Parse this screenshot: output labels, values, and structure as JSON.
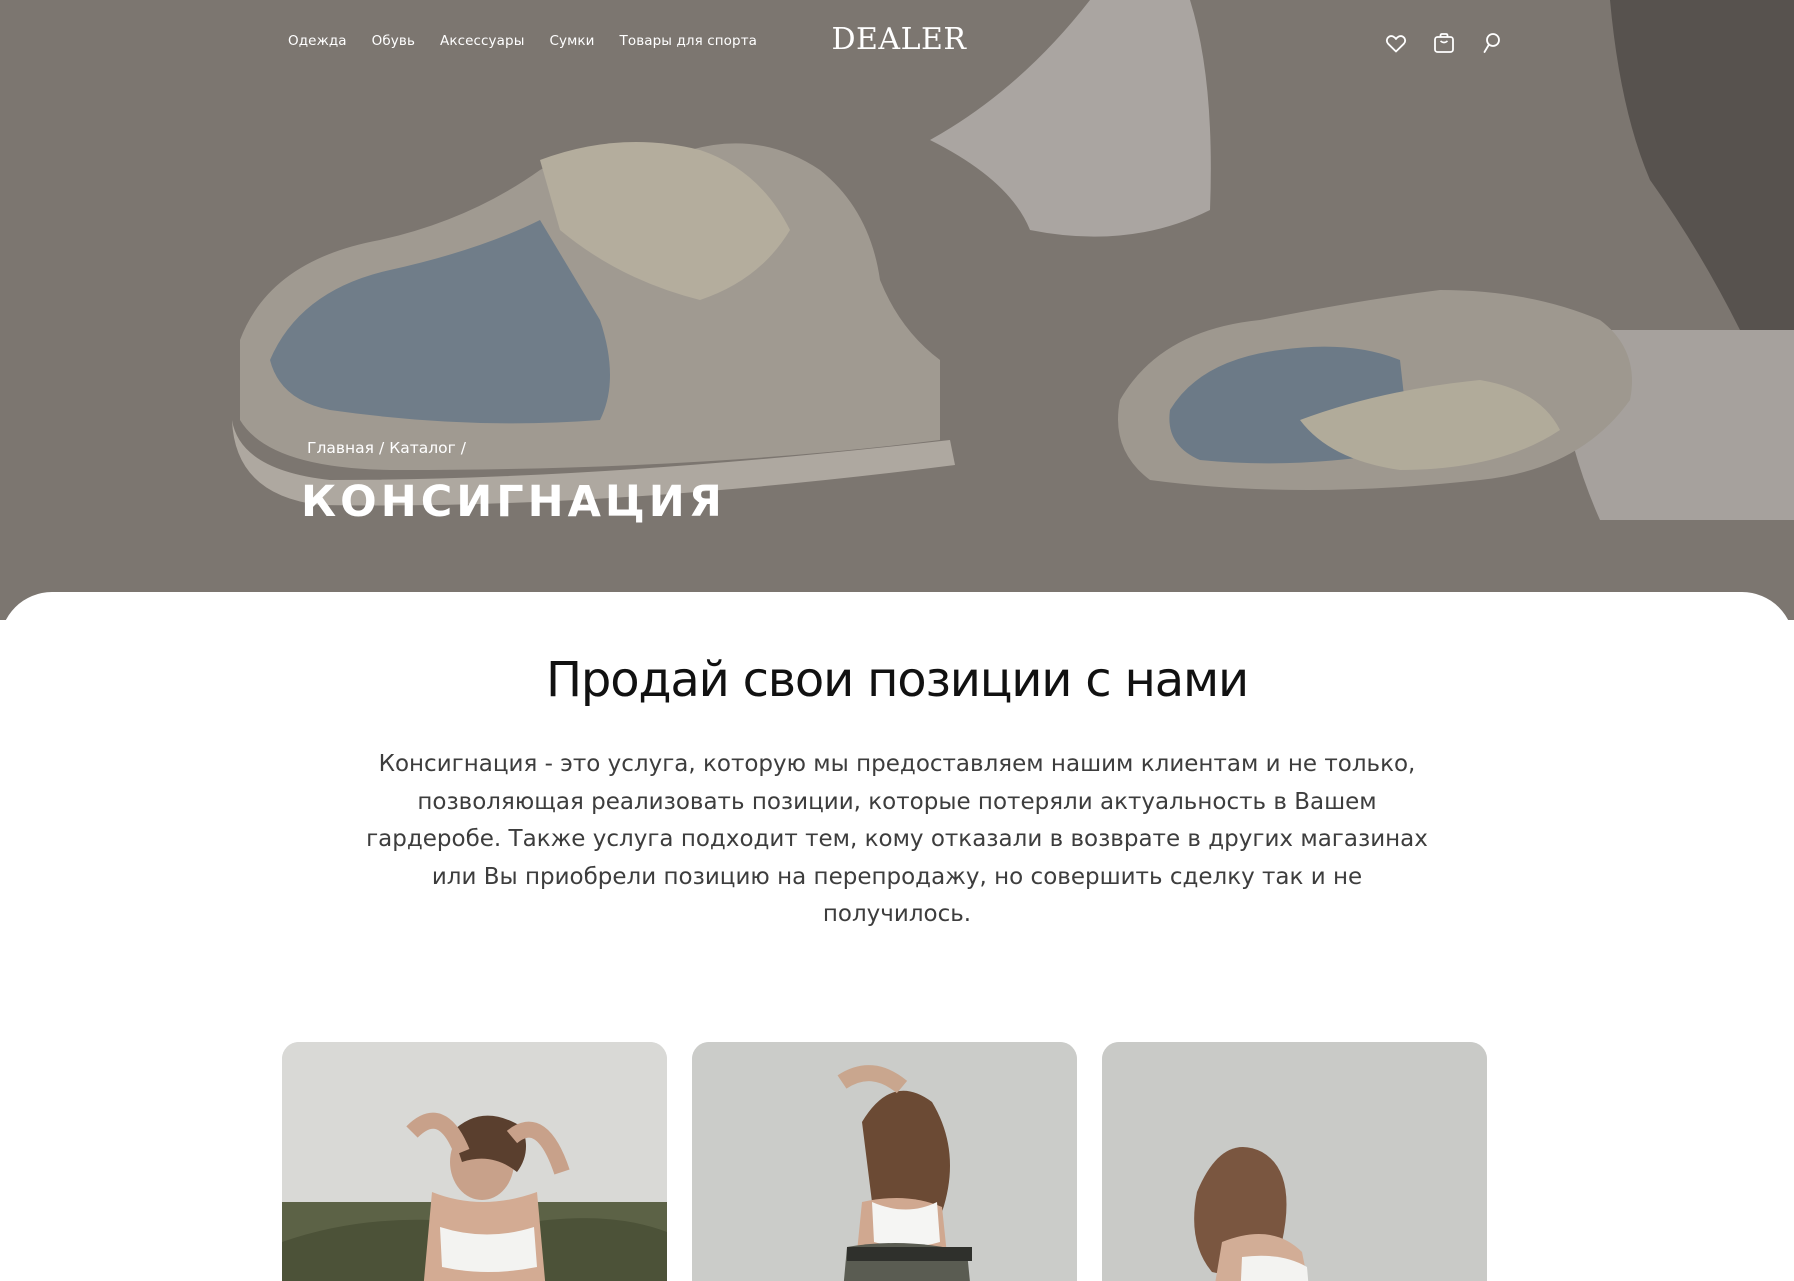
{
  "header": {
    "nav": [
      "Одежда",
      "Обувь",
      "Аксессуары",
      "Сумки",
      "Товары для спорта"
    ],
    "logo": "DEALER",
    "icons": [
      "heart-icon",
      "bag-icon",
      "search-icon"
    ]
  },
  "hero": {
    "breadcrumb": [
      "Главная",
      "Каталог"
    ],
    "breadcrumb_separator": "/",
    "title": "КОНСИГНАЦИЯ",
    "image": "sneakers-photo"
  },
  "main": {
    "title": "Продай свои позиции с нами",
    "description": "Консигнация - это услуга, которую мы предоставляем нашим клиентам и не только, позволяющая реализовать позиции, которые потеряли актуальность в Вашем гардеробе. Также услуга подходит тем, кому отказали в возврате в других магазинах или Вы приобрели позицию на перепродажу, но совершить сделку так и не получилось."
  },
  "cards": [
    {
      "image": "model-photo-1"
    },
    {
      "image": "model-photo-2"
    },
    {
      "image": "model-photo-3"
    }
  ],
  "colors": {
    "text_dark": "#111111",
    "text_body": "#3d3d3d",
    "hero_overlay": "#8d877f",
    "white": "#ffffff"
  }
}
